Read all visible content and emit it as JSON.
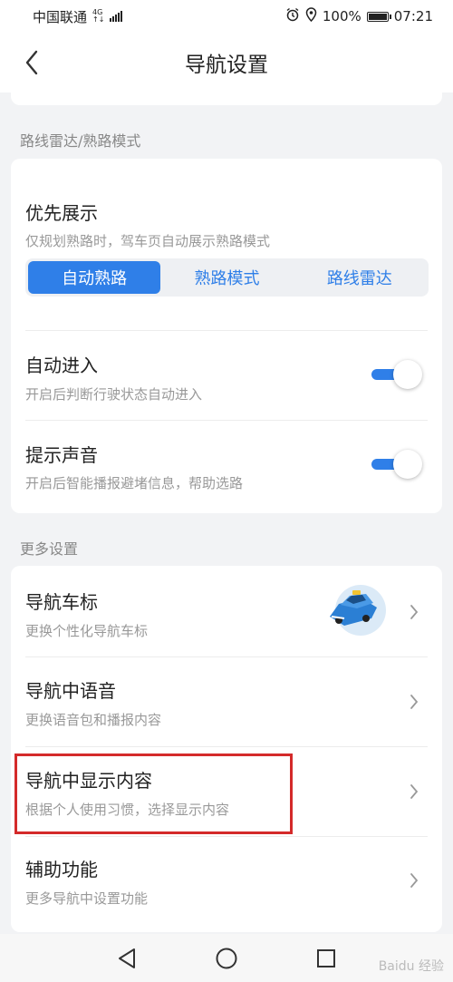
{
  "status_bar": {
    "carrier": "中国联通",
    "network_top": "4G",
    "network_bottom": "↑↓",
    "battery": "100%",
    "time": "07:21"
  },
  "header": {
    "title": "导航设置"
  },
  "route_radar": {
    "section_label": "路线雷达/熟路模式",
    "priority": {
      "title": "优先展示",
      "subtitle": "仅规划熟路时，驾车页自动展示熟路模式",
      "options": [
        "自动熟路",
        "熟路模式",
        "路线雷达"
      ],
      "selected": "自动熟路"
    },
    "auto_enter": {
      "title": "自动进入",
      "subtitle": "开启后判断行驶状态自动进入",
      "enabled": true
    },
    "sound": {
      "title": "提示声音",
      "subtitle": "开启后智能播报避堵信息，帮助选路",
      "enabled": true
    }
  },
  "more_settings": {
    "section_label": "更多设置",
    "items": [
      {
        "title": "导航车标",
        "subtitle": "更换个性化导航车标"
      },
      {
        "title": "导航中语音",
        "subtitle": "更换语音包和播报内容"
      },
      {
        "title": "导航中显示内容",
        "subtitle": "根据个人使用习惯，选择显示内容"
      },
      {
        "title": "辅助功能",
        "subtitle": "更多导航中设置功能"
      }
    ]
  },
  "colors": {
    "accent": "#2f7fe8",
    "highlight": "#d42a2a"
  },
  "watermark": "Baidu 经验"
}
